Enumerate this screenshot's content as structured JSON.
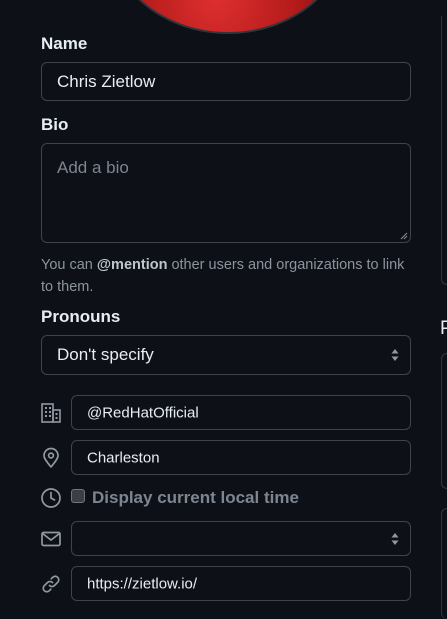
{
  "profile": {
    "name_label": "Name",
    "name_value": "Chris Zietlow",
    "bio_label": "Bio",
    "bio_placeholder": "Add a bio",
    "mention_prefix": "You can ",
    "mention_word": "@mention",
    "mention_suffix": " other users and organizations to link to them.",
    "pronouns_label": "Pronouns",
    "pronouns_value": "Don't specify",
    "company_value": "@RedHatOfficial",
    "location_value": "Charleston",
    "local_time_label": "Display current local time",
    "local_time_checked": false,
    "email_value": "",
    "website_value": "https://zietlow.io/"
  },
  "side": {
    "partial_letter": "P"
  },
  "icons": {
    "company": "building-icon",
    "location": "location-pin-icon",
    "time": "clock-icon",
    "email": "mail-icon",
    "website": "link-icon"
  },
  "colors": {
    "background": "#0d1117",
    "border": "#3d444d",
    "text": "#e6edf3",
    "muted": "#8b949e"
  }
}
